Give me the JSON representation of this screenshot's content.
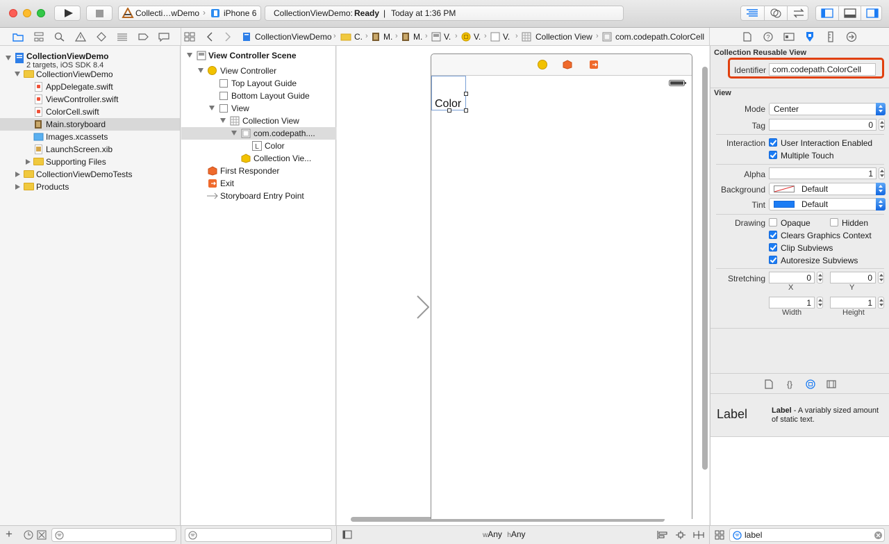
{
  "toolbar": {
    "scheme_name": "Collecti…wDemo",
    "device_name": "iPhone 6",
    "status_project": "CollectionViewDemo:",
    "status_state": "Ready",
    "status_divider": "|",
    "status_time": "Today at 1:36 PM"
  },
  "jumpbar": {
    "crumbs": [
      "CollectionViewDemo",
      "C.",
      "M.",
      "M.",
      "V.",
      "V.",
      "V.",
      "Collection View",
      "com.codepath.ColorCell"
    ]
  },
  "navigator": {
    "project_name": "CollectionViewDemo",
    "project_sub": "2 targets, iOS SDK 8.4",
    "group_main": "CollectionViewDemo",
    "files": [
      "AppDelegate.swift",
      "ViewController.swift",
      "ColorCell.swift",
      "Main.storyboard",
      "Images.xcassets",
      "LaunchScreen.xib"
    ],
    "supporting": "Supporting Files",
    "tests": "CollectionViewDemoTests",
    "products": "Products"
  },
  "outline": {
    "scene": "View Controller Scene",
    "vc": "View Controller",
    "top_guide": "Top Layout Guide",
    "bottom_guide": "Bottom Layout Guide",
    "view": "View",
    "collection_view": "Collection View",
    "cell": "com.codepath....",
    "label_color": "Color",
    "collection_layout": "Collection Vie...",
    "first_responder": "First Responder",
    "exit": "Exit",
    "entry_point": "Storyboard Entry Point"
  },
  "canvas": {
    "cell_label": "Color",
    "size_w_prefix": "w",
    "size_w": "Any",
    "size_h_prefix": "h",
    "size_h": "Any"
  },
  "inspector": {
    "section_reusable": "Collection Reusable View",
    "identifier_label": "Identifier",
    "identifier_value": "com.codepath.ColorCell",
    "section_view": "View",
    "mode_label": "Mode",
    "mode_value": "Center",
    "tag_label": "Tag",
    "tag_value": "0",
    "interaction_label": "Interaction",
    "user_interaction": "User Interaction Enabled",
    "multiple_touch": "Multiple Touch",
    "alpha_label": "Alpha",
    "alpha_value": "1",
    "background_label": "Background",
    "background_value": "Default",
    "tint_label": "Tint",
    "tint_value": "Default",
    "drawing_label": "Drawing",
    "opaque": "Opaque",
    "hidden": "Hidden",
    "clears_graphics": "Clears Graphics Context",
    "clip_subviews": "Clip Subviews",
    "autoresize_subviews": "Autoresize Subviews",
    "stretching_label": "Stretching",
    "stretch_x": "0",
    "stretch_y": "0",
    "x_caption": "X",
    "y_caption": "Y",
    "stretch_w": "1",
    "stretch_h": "1",
    "width_caption": "Width",
    "height_caption": "Height",
    "checkbox_states": {
      "user_interaction": true,
      "multiple_touch": true,
      "opaque": false,
      "hidden": false,
      "clears_graphics": true,
      "clip_subviews": true,
      "autoresize_subviews": true
    }
  },
  "library": {
    "item_icon_text": "Label",
    "item_title": "Label",
    "item_desc": " - A variably sized amount of static text.",
    "search_value": "label"
  },
  "colors": {
    "accent_blue": "#1b7cf4",
    "identifier_highlight": "#e0400e",
    "vc_yellow": "#f2c200",
    "exit_orange": "#ef6a2c"
  }
}
